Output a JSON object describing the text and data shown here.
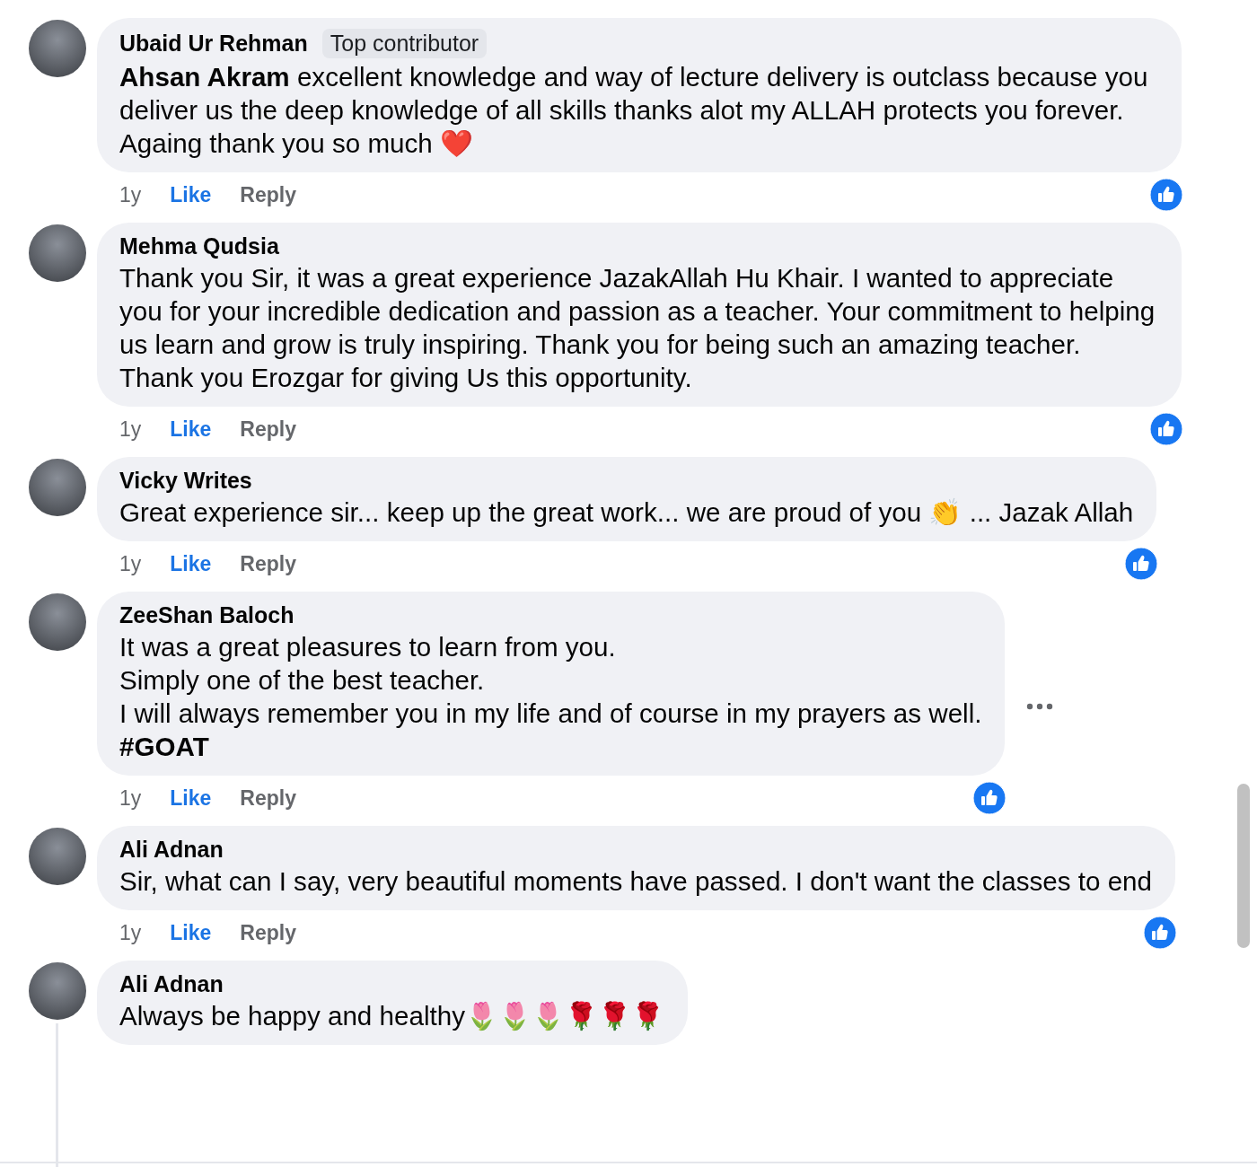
{
  "comments": [
    {
      "author": "Ubaid Ur Rehman",
      "badge": "Top contributor",
      "text": "**Ahsan Akram** excellent knowledge and way of lecture delivery is outclass because you deliver us the deep knowledge of all skills thanks alot my ALLAH protects you forever.\nAgaing thank you so much ❤️",
      "time": "1y",
      "like": "Like",
      "reply": "Reply",
      "liked": true,
      "reaction": true,
      "more_menu": false
    },
    {
      "author": "Mehma Qudsia",
      "text": "Thank you Sir, it was a great experience JazakAllah Hu Khair. I wanted to appreciate you for your incredible dedication and passion as a teacher. Your commitment to helping us learn and grow is truly inspiring. Thank you for being such an amazing teacher. Thank you Erozgar for giving Us this opportunity.",
      "time": "1y",
      "like": "Like",
      "reply": "Reply",
      "liked": true,
      "reaction": true,
      "more_menu": false
    },
    {
      "author": "Vicky Writes",
      "text": "Great experience sir... keep up the great work... we are proud of you 👏 ... Jazak Allah",
      "time": "1y",
      "like": "Like",
      "reply": "Reply",
      "liked": true,
      "reaction": true,
      "more_menu": false
    },
    {
      "author": "ZeeShan Baloch",
      "text": "It was a great pleasures to learn from you.\nSimply one of the best teacher.\nI will always remember you in my life and of course in my prayers as well.\n**#GOAT**",
      "time": "1y",
      "like": "Like",
      "reply": "Reply",
      "liked": true,
      "reaction": true,
      "more_menu": true
    },
    {
      "author": "Ali Adnan",
      "text": "Sir, what can I say, very beautiful moments have passed. I don't want the classes to end",
      "time": "1y",
      "like": "Like",
      "reply": "Reply",
      "liked": true,
      "reaction": true,
      "more_menu": false
    },
    {
      "author": "Ali Adnan",
      "text": "Always be happy and healthy🌷🌷🌷🌹🌹🌹",
      "has_replies": true,
      "more_menu": false
    }
  ]
}
